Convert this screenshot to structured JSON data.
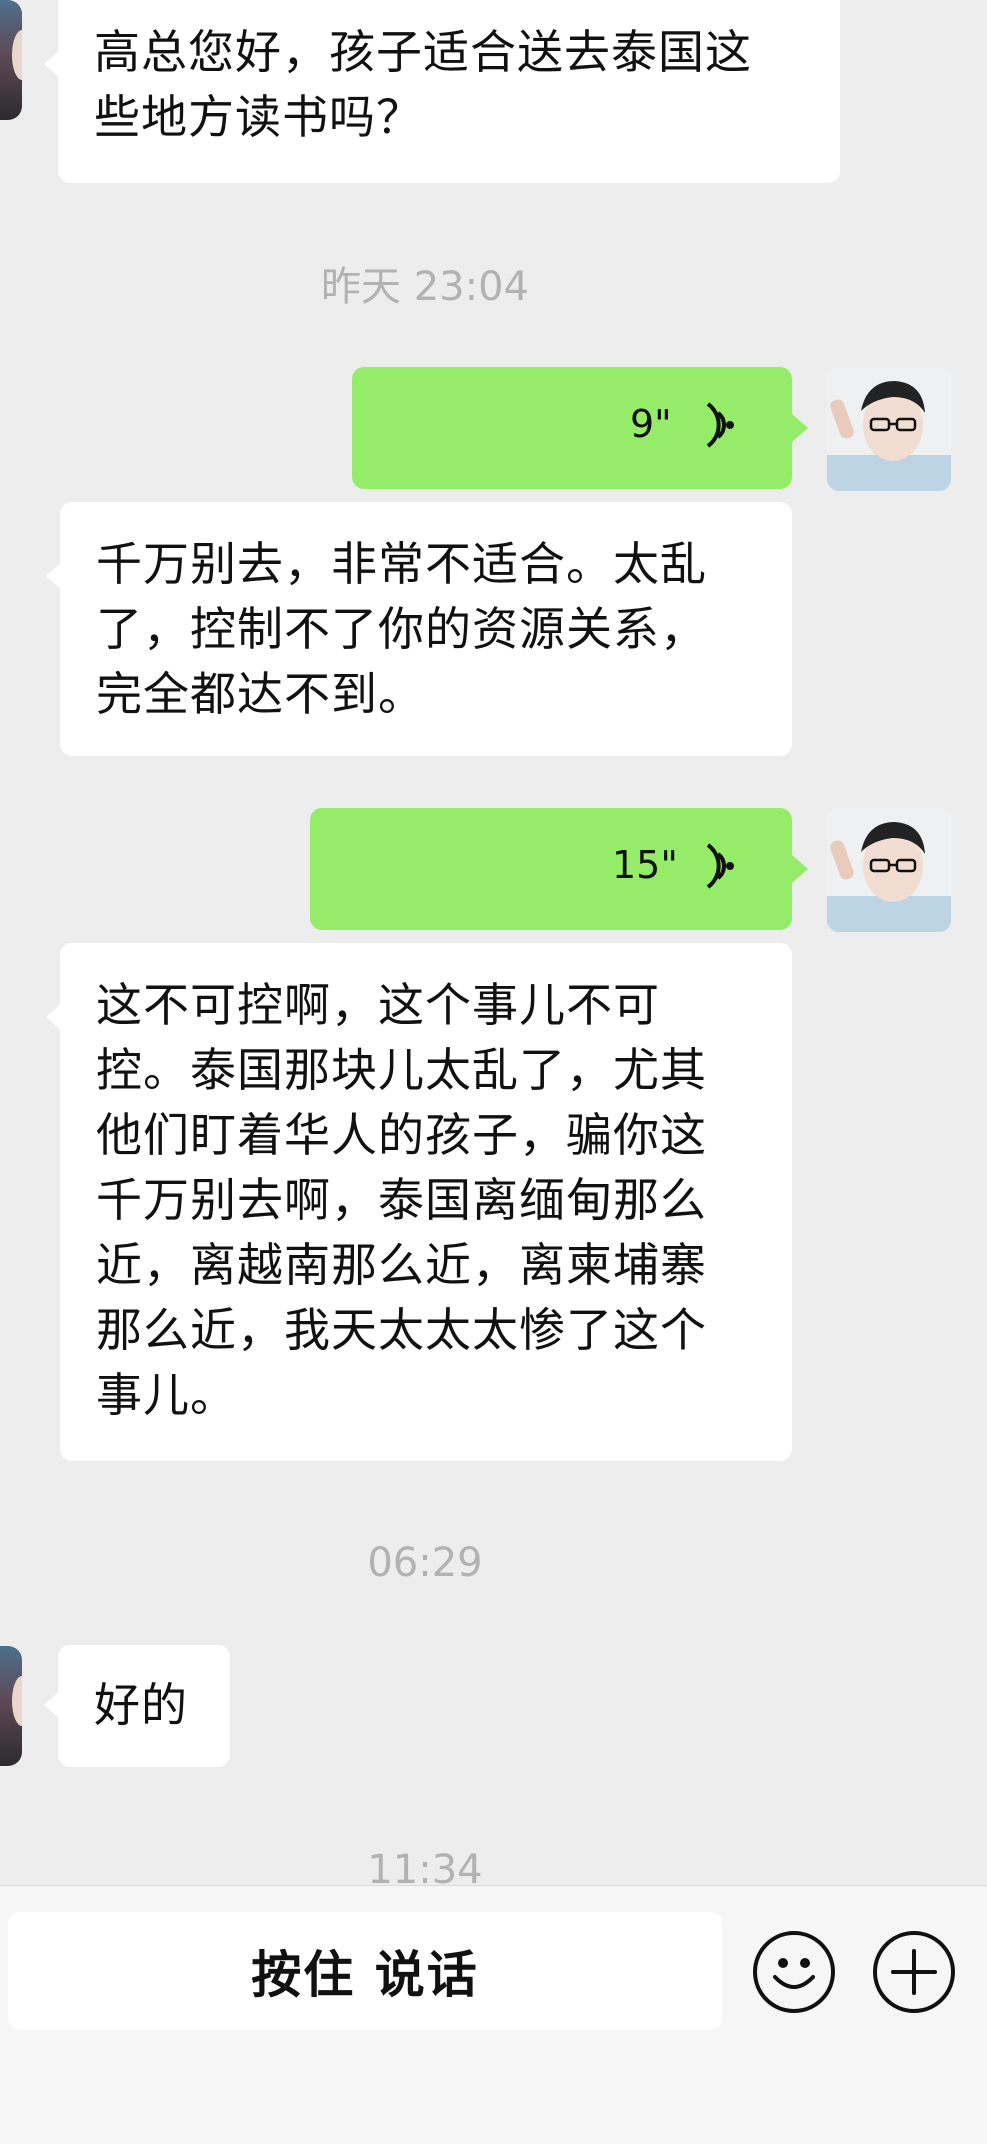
{
  "messages": {
    "m1": {
      "sender": "other",
      "text": "高总您好，孩子适合送去泰国这\n些地方读书吗？"
    },
    "ts1": "昨天 23:04",
    "v1": {
      "sender": "me",
      "duration": "9\""
    },
    "m2": {
      "sender": "other",
      "text": "千万别去，非常不适合。太乱\n了，控制不了你的资源关系，\n完全都达不到。"
    },
    "v2": {
      "sender": "me",
      "duration": "15\""
    },
    "m3": {
      "sender": "other",
      "text": "这不可控啊，这个事儿不可\n控。泰国那块儿太乱了，尤其\n他们盯着华人的孩子，骗你这\n千万别去啊，泰国离缅甸那么\n近，离越南那么近，离柬埔寨\n那么近，我天太太太惨了这个\n事儿。"
    },
    "ts2": "06:29",
    "m4": {
      "sender": "other",
      "text": "好的"
    },
    "ts3": "11:34"
  },
  "input_bar": {
    "hold_to_talk_label": "按住 说话",
    "emoji_icon": "smiley-face-icon",
    "plus_icon": "plus-circle-icon"
  },
  "colors": {
    "background": "#ededed",
    "incoming_bubble": "#ffffff",
    "outgoing_bubble": "#95ec69",
    "timestamp": "#b2b2b2"
  }
}
